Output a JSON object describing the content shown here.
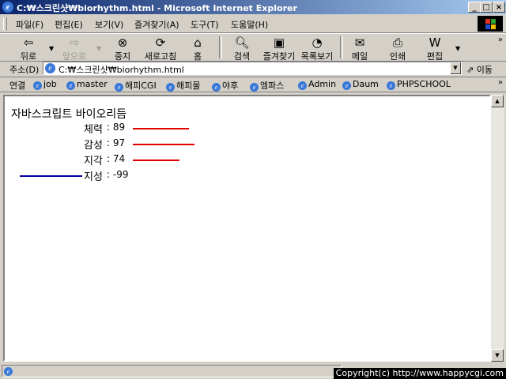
{
  "window": {
    "title": "C:₩스크린샷₩biorhythm.html - Microsoft Internet Explorer"
  },
  "menu": [
    "파일(F)",
    "편집(E)",
    "보기(V)",
    "즐겨찾기(A)",
    "도구(T)",
    "도움말(H)"
  ],
  "toolbar": {
    "back": "뒤로",
    "forward": "앞으로",
    "stop": "중지",
    "refresh": "새로고침",
    "home": "홈",
    "search": "검색",
    "favorites": "즐겨찾기",
    "history": "목록보기",
    "mail": "메일",
    "print": "인쇄",
    "edit": "편집"
  },
  "address": {
    "label": "주소(D)",
    "url": "C:₩스크린샷₩biorhythm.html",
    "go": "이동"
  },
  "links": {
    "label": "연결",
    "items": [
      "job",
      "master",
      "해피CGI",
      "해피몰",
      "야후",
      "엠파스",
      "Admin",
      "Daum",
      "PHPSCHOOL"
    ]
  },
  "page": {
    "title": "자바스크립트 바이오리듬",
    "rows": [
      {
        "name": "체력",
        "value": "89",
        "num": 89,
        "color": "#e00000"
      },
      {
        "name": "감성",
        "value": "97",
        "num": 97,
        "color": "#e00000"
      },
      {
        "name": "지각",
        "value": "74",
        "num": 74,
        "color": "#e00000"
      },
      {
        "name": "지성",
        "value": "-99",
        "num": -99,
        "color": "#0000a0"
      }
    ]
  },
  "footer": {
    "copyright": "Copyright(c) http://www.happycgi.com"
  }
}
